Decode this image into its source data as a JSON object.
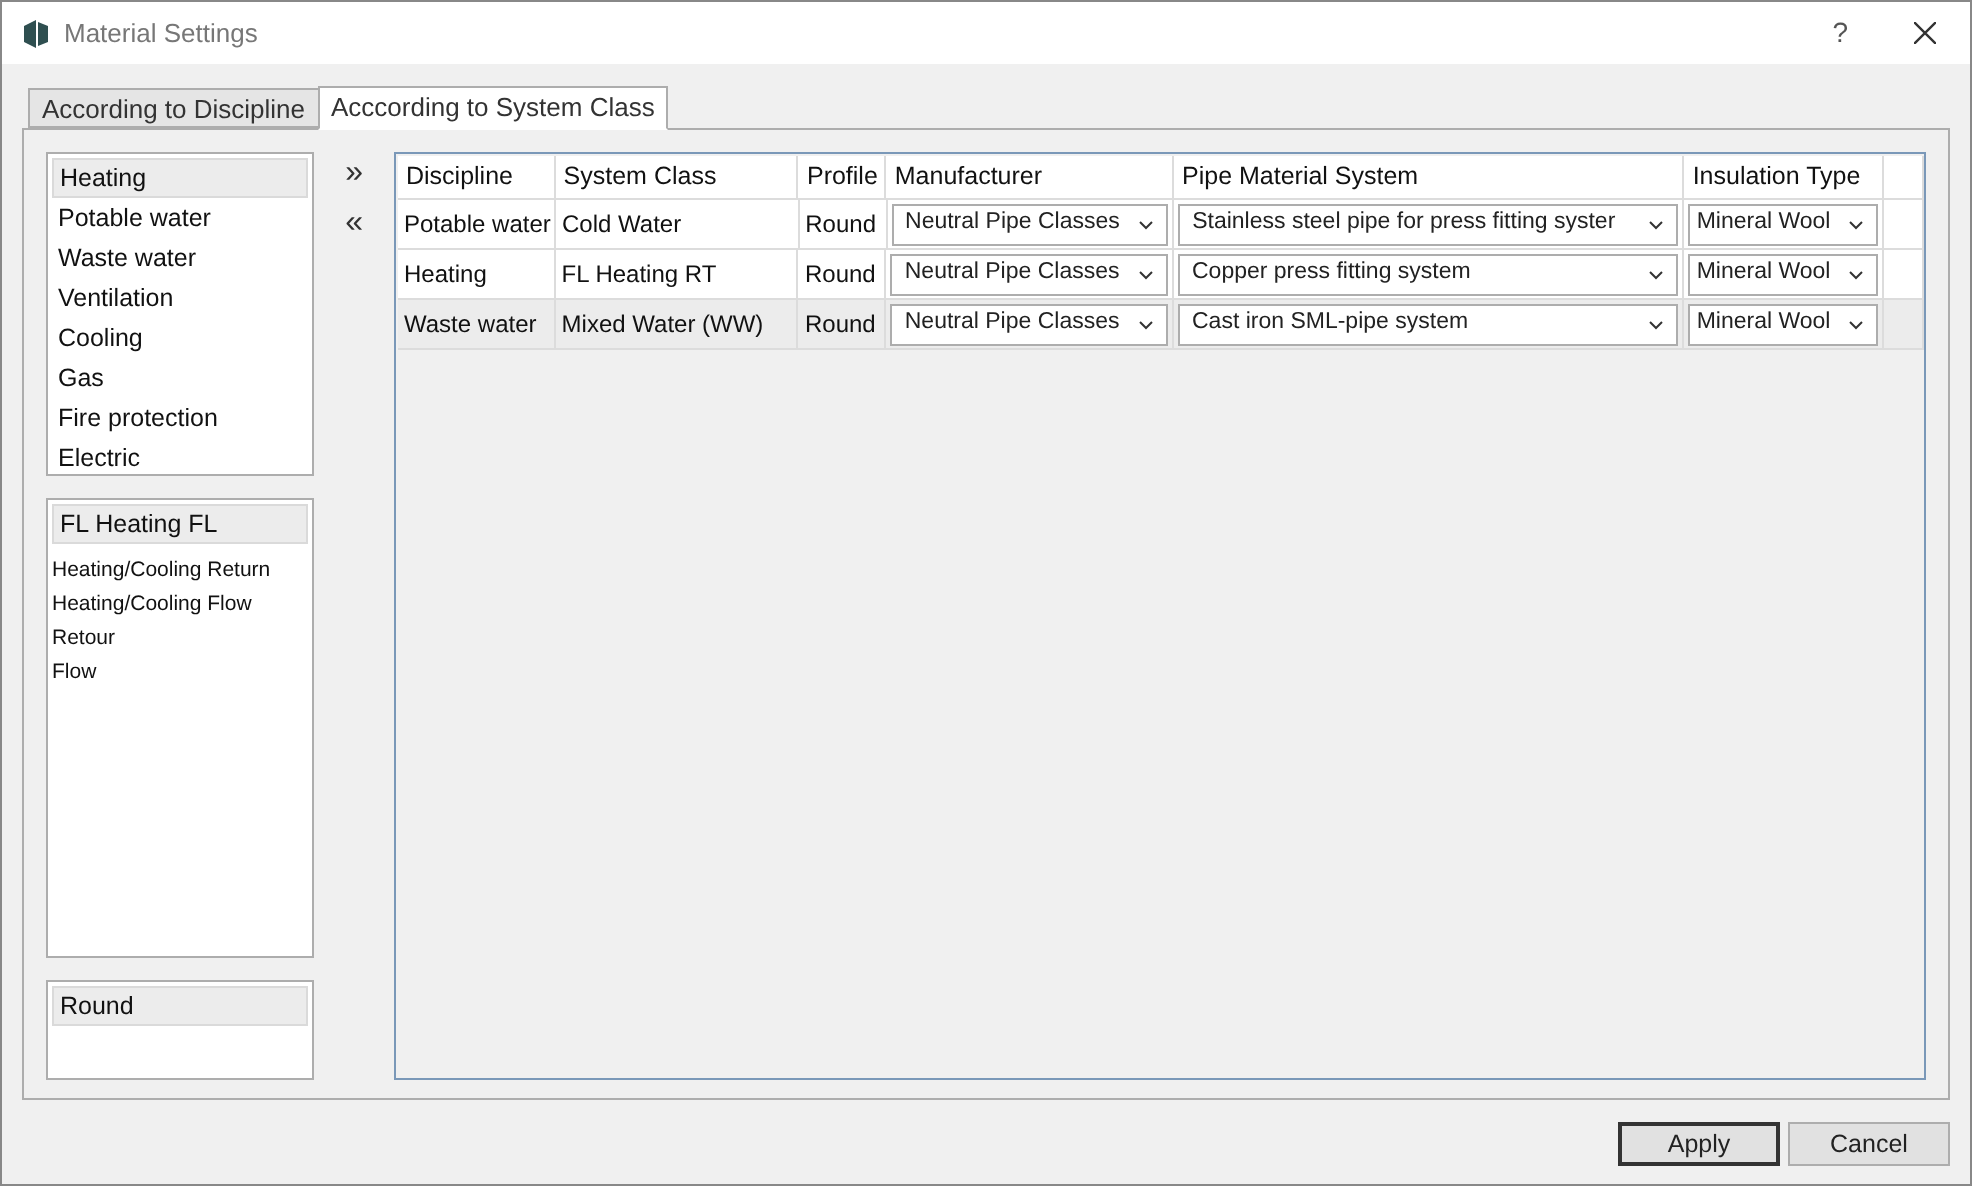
{
  "window": {
    "title": "Material Settings",
    "help": "?"
  },
  "tabs": [
    {
      "label": "According to Discipline",
      "selected": false
    },
    {
      "label": "Acccording to System Class",
      "selected": true
    }
  ],
  "disciplines": [
    {
      "label": "Heating",
      "selected": true
    },
    {
      "label": "Potable water",
      "selected": false
    },
    {
      "label": "Waste water",
      "selected": false
    },
    {
      "label": "Ventilation",
      "selected": false
    },
    {
      "label": "Cooling",
      "selected": false
    },
    {
      "label": "Gas",
      "selected": false
    },
    {
      "label": "Fire protection",
      "selected": false
    },
    {
      "label": "Electric",
      "selected": false
    }
  ],
  "system_classes": {
    "header": "FL Heating FL",
    "items": [
      "Heating/Cooling Return",
      "Heating/Cooling Flow",
      "Retour",
      "Flow"
    ]
  },
  "profiles": {
    "header": "Round"
  },
  "move_buttons": [
    "»",
    "«"
  ],
  "table": {
    "columns": [
      "Discipline",
      "System Class",
      "Profile",
      "Manufacturer",
      "Pipe Material System",
      "Insulation Type"
    ],
    "rows": [
      {
        "selected": false,
        "discipline": "Potable water",
        "system_class": "Cold Water",
        "profile": "Round",
        "manufacturer": "Neutral Pipe Classes",
        "pipe_material_system": "Stainless steel pipe for press fitting syster",
        "insulation_type": "Mineral Wool"
      },
      {
        "selected": false,
        "discipline": "Heating",
        "system_class": "FL Heating RT",
        "profile": "Round",
        "manufacturer": "Neutral Pipe Classes",
        "pipe_material_system": "Copper press fitting system",
        "insulation_type": "Mineral Wool"
      },
      {
        "selected": true,
        "discipline": "Waste water",
        "system_class": "Mixed Water (WW)",
        "profile": "Round",
        "manufacturer": "Neutral Pipe Classes",
        "pipe_material_system": "Cast iron SML-pipe system",
        "insulation_type": "Mineral Wool"
      }
    ]
  },
  "buttons": [
    "Apply",
    "Cancel"
  ]
}
